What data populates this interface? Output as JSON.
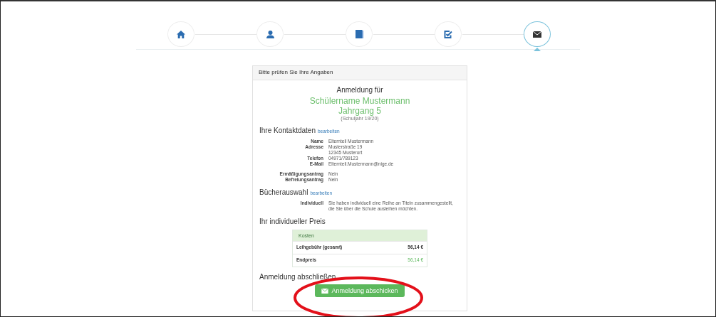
{
  "steps": [
    {
      "kind": "home",
      "selected": false
    },
    {
      "kind": "user",
      "selected": false
    },
    {
      "kind": "book",
      "selected": false
    },
    {
      "kind": "check",
      "selected": false
    },
    {
      "kind": "envelope",
      "selected": true
    }
  ],
  "panel": {
    "title": "Bitte prüfen Sie Ihre Angaben",
    "intro": "Anmeldung für",
    "student": "Schülername Mustermann",
    "grade": "Jahrgang 5",
    "school_year": "(Schuljahr 19/20)",
    "sections": [
      {
        "kind": "details",
        "heading": "Ihre Kontaktdaten",
        "edit_link": "bearbeiten",
        "groups": [
          [
            {
              "label": "Name",
              "value": "Elternteil Mustermann"
            },
            {
              "label": "Adresse",
              "value": "Musterstraße 19"
            },
            {
              "value": "12345 Musterort"
            },
            {
              "label": "Telefon",
              "value": "04971/789123"
            },
            {
              "label": "E-Mail",
              "value": "Elternteil.Mustermann@nige.de"
            }
          ],
          [
            {
              "label": "Ermäßigungsantrag",
              "value": "Nein"
            },
            {
              "label": "Befreiungsantrag",
              "value": "Nein"
            }
          ]
        ]
      },
      {
        "kind": "details",
        "heading": "Bücherauswahl",
        "edit_link": "bearbeiten",
        "groups": [
          [
            {
              "label": "Individuell",
              "value": "Sie haben individuell eine Reihe an Titeln zusammengestellt, die Sie über die Schule ausleihen möchten."
            }
          ]
        ]
      },
      {
        "kind": "price",
        "heading": "Ihr individueller Preis",
        "table_title": "Kosten",
        "rows": [
          {
            "label": "Leihgebühr (gesamt)",
            "value": "56,14 €",
            "highlight": false
          },
          {
            "label": "Endpreis",
            "value": "56,14 €",
            "highlight": true
          }
        ]
      },
      {
        "kind": "submit",
        "heading": "Anmeldung abschließen",
        "button": "Anmeldung abschicken"
      }
    ]
  }
}
